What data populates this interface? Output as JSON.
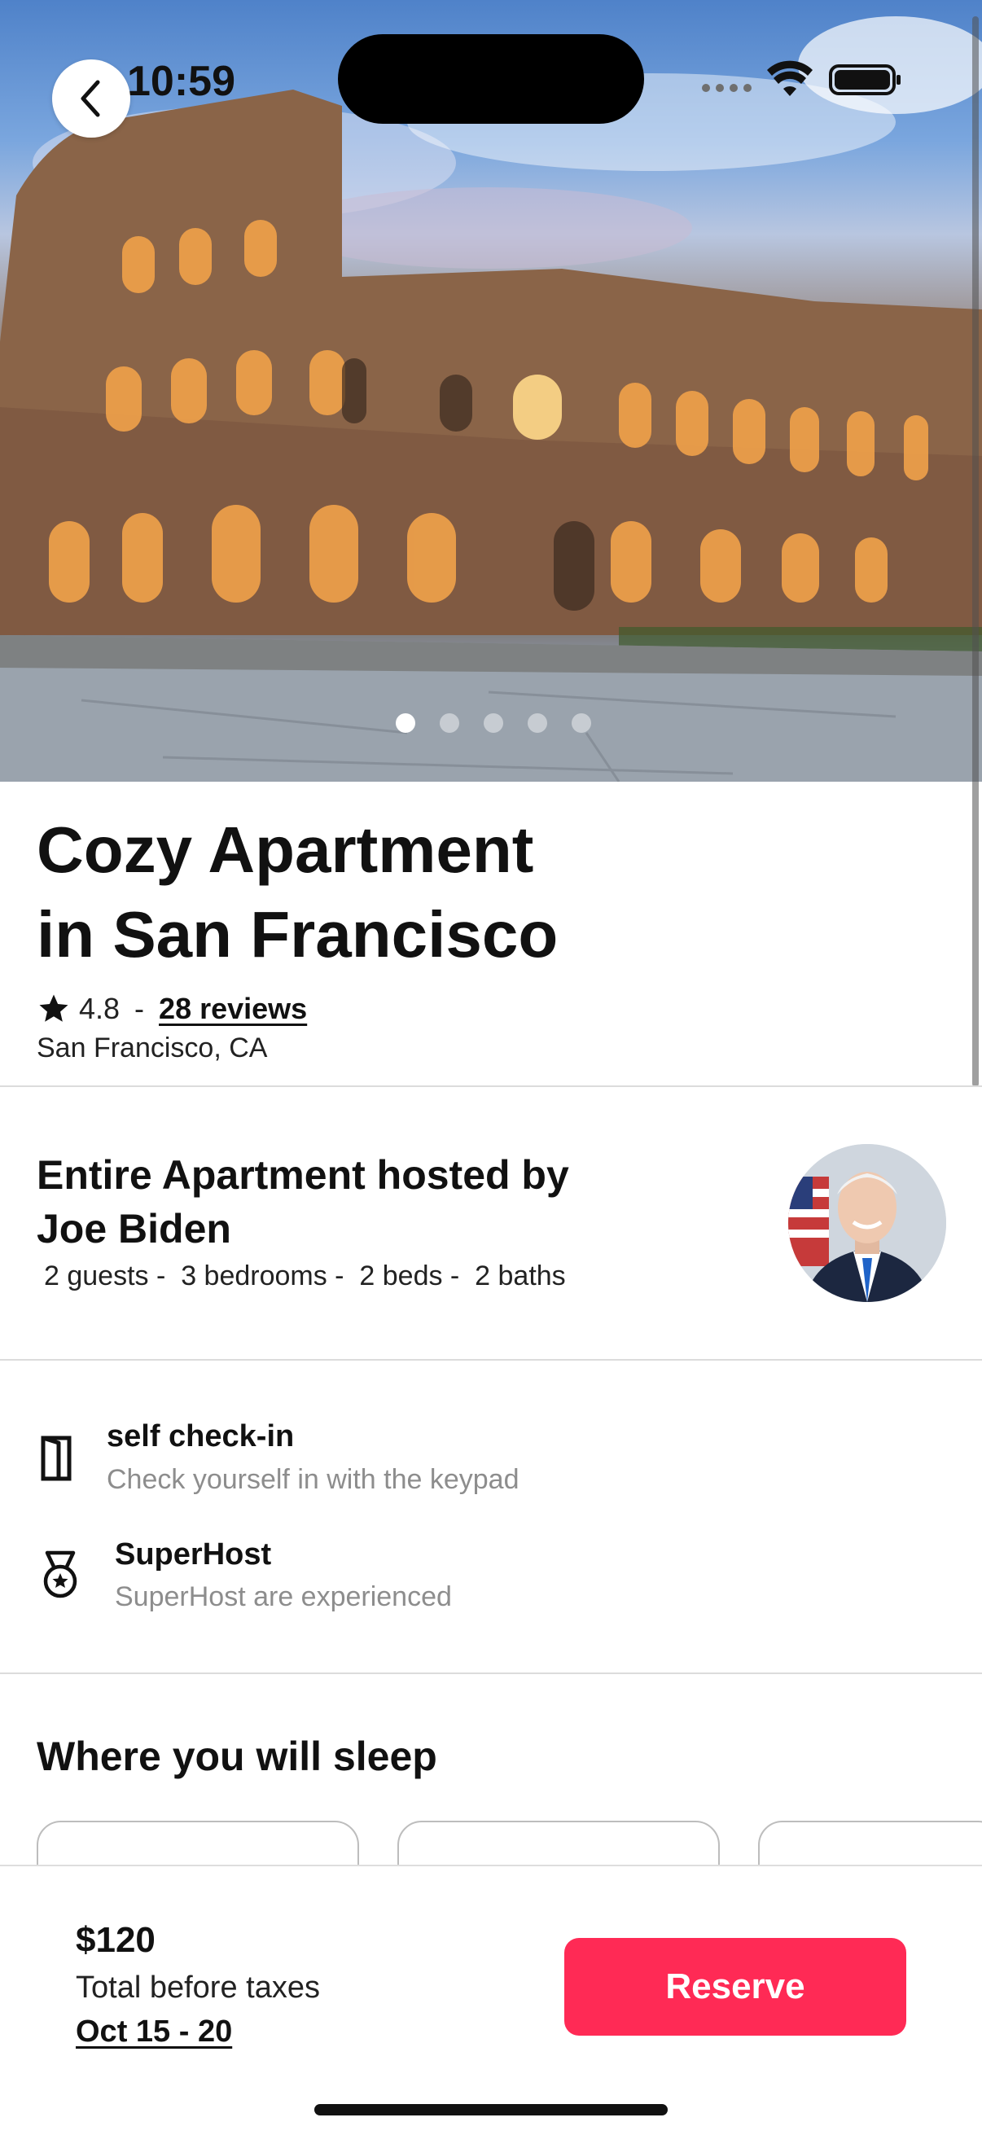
{
  "status_bar": {
    "time": "10:59"
  },
  "hero": {
    "image": "colosseum-photo",
    "slide_count": 5,
    "active_slide": 1
  },
  "listing": {
    "title_line1": "Cozy Apartment",
    "title_line2": "in San Francisco",
    "rating": "4.8",
    "separator": "-",
    "reviews_label": "28 reviews",
    "location": "San Francisco, CA"
  },
  "host": {
    "title_line1": "Entire Apartment hosted by",
    "title_line2": "Joe Biden",
    "details": "2 guests -  3 bedrooms -  2 beds -  2 baths"
  },
  "features": [
    {
      "icon": "door-icon",
      "title": "self check-in",
      "subtitle": "Check yourself in with the keypad"
    },
    {
      "icon": "medal-icon",
      "title": "SuperHost",
      "subtitle": "SuperHost are experienced"
    }
  ],
  "sleep": {
    "title": "Where you will sleep"
  },
  "footer": {
    "price": "$120",
    "price_note": "Total before taxes",
    "dates": "Oct 15 - 20",
    "reserve_label": "Reserve",
    "reserve_color": "#ff2a55"
  }
}
